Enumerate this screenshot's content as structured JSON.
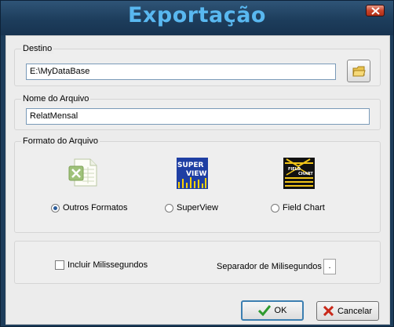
{
  "window": {
    "title": "Exportação"
  },
  "destino": {
    "label": "Destino",
    "path": "E:\\MyDataBase"
  },
  "arquivo": {
    "label": "Nome do Arquivo",
    "name": "RelatMensal"
  },
  "formato": {
    "label": "Formato do Arquivo",
    "options": [
      {
        "label": "Outros Formatos",
        "icon": "excel-icon",
        "selected": true
      },
      {
        "label": "SuperView",
        "icon": "superview-icon",
        "selected": false
      },
      {
        "label": "Field Chart",
        "icon": "fieldchart-icon",
        "selected": false
      }
    ],
    "superview_logo": [
      "SUPER",
      "VIEW"
    ],
    "fieldchart_logo": [
      "FIELD",
      "CHART"
    ]
  },
  "opcoes": {
    "ms_label": "Incluir Milissegundos",
    "ms_checked": false,
    "sep_label": "Separador de Milisegundos",
    "sep_value": "."
  },
  "buttons": {
    "ok": "OK",
    "cancel": "Cancelar"
  }
}
